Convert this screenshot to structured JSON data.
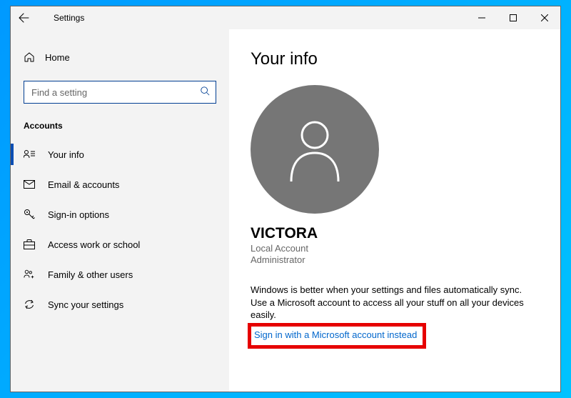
{
  "window": {
    "title": "Settings"
  },
  "sidebar": {
    "home": "Home",
    "search_placeholder": "Find a setting",
    "section": "Accounts",
    "items": [
      {
        "label": "Your info"
      },
      {
        "label": "Email & accounts"
      },
      {
        "label": "Sign-in options"
      },
      {
        "label": "Access work or school"
      },
      {
        "label": "Family & other users"
      },
      {
        "label": "Sync your settings"
      }
    ]
  },
  "main": {
    "title": "Your info",
    "username": "VICTORA",
    "account_type": "Local Account",
    "account_role": "Administrator",
    "promo": "Windows is better when your settings and files automatically sync. Use a Microsoft account to access all your stuff on all your devices easily.",
    "signin_link": "Sign in with a Microsoft account instead"
  }
}
